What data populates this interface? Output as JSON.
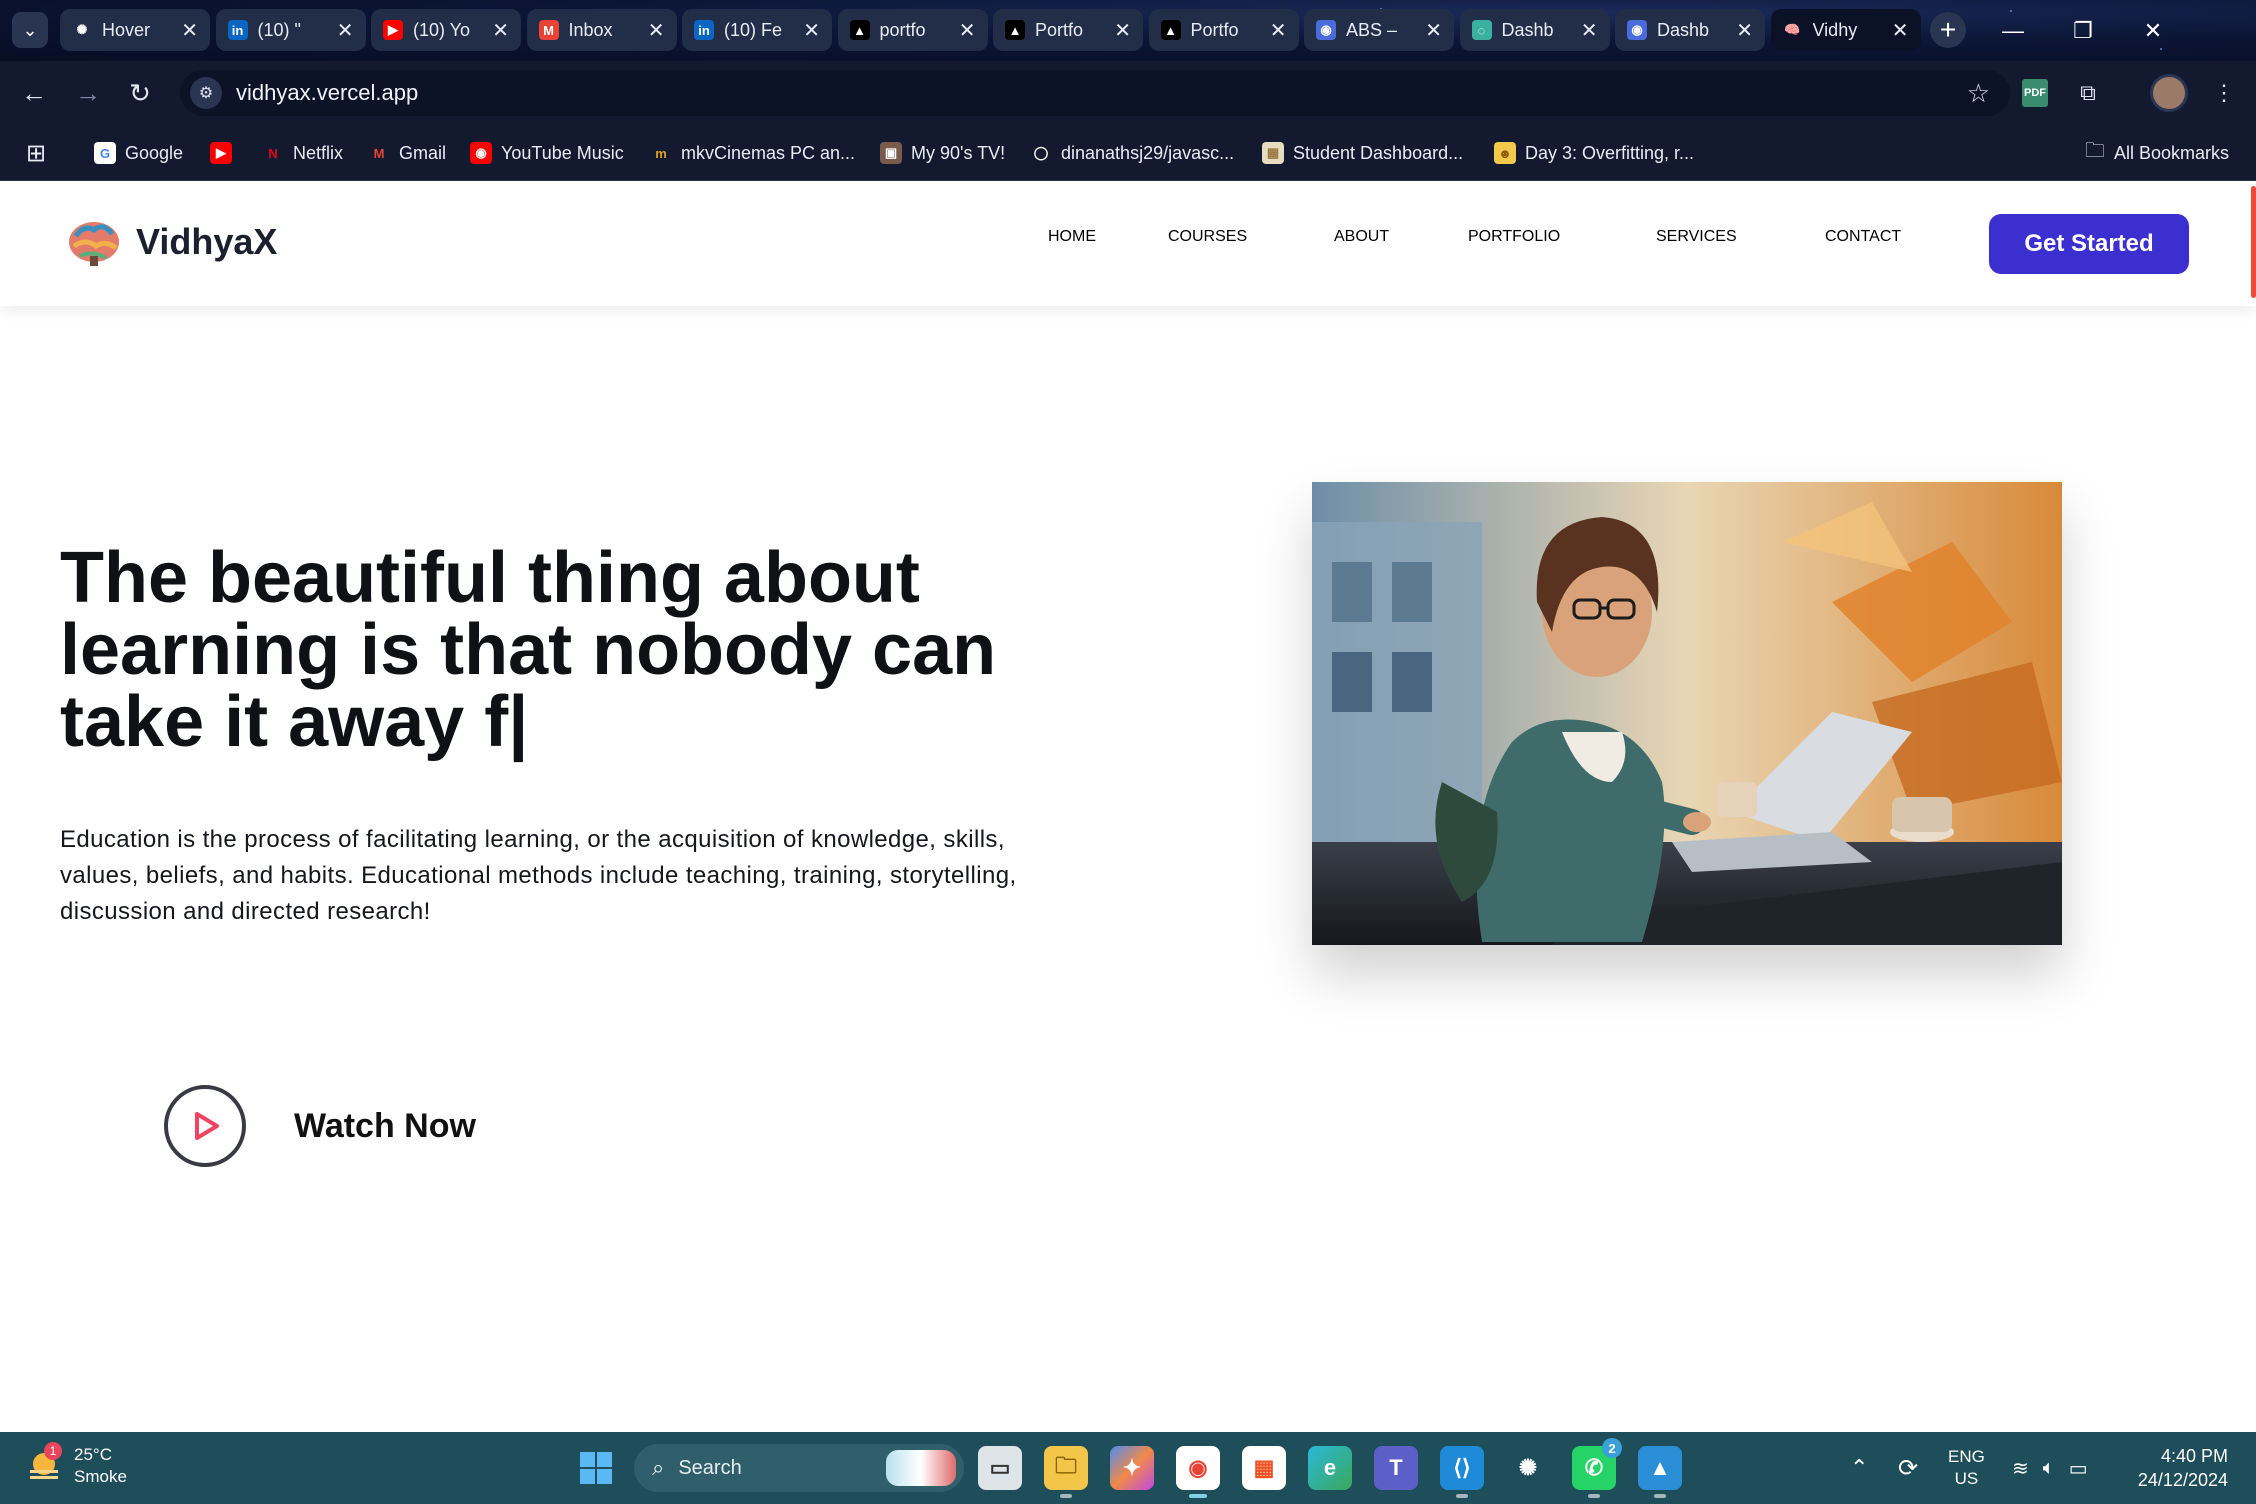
{
  "browser": {
    "tabs": [
      {
        "title": "Hover",
        "fav": "openai",
        "color": "#222d48"
      },
      {
        "title": "(10) \"",
        "fav": "in",
        "color": "#0a66c2"
      },
      {
        "title": "(10) Yo",
        "fav": "▶",
        "color": "#ff0000"
      },
      {
        "title": "Inbox",
        "fav": "M",
        "color": "#ea4335"
      },
      {
        "title": "(10) Fe",
        "fav": "in",
        "color": "#0a66c2"
      },
      {
        "title": "portfo",
        "fav": "▲",
        "color": "#000000"
      },
      {
        "title": "Portfo",
        "fav": "▲",
        "color": "#000000"
      },
      {
        "title": "Portfo",
        "fav": "▲",
        "color": "#000000"
      },
      {
        "title": "ABS –",
        "fav": "◉",
        "color": "#4b6bdc"
      },
      {
        "title": "Dashb",
        "fav": "◌",
        "color": "#3ab0a0"
      },
      {
        "title": "Dashb",
        "fav": "◉",
        "color": "#4b6bdc"
      },
      {
        "title": "Vidhy",
        "fav": "🧠",
        "color": "#0b1228"
      }
    ],
    "url": "vidhyax.vercel.app",
    "bookmarks": [
      {
        "label": "Google",
        "fav": "G",
        "color": "#ffffff",
        "fg": "#4285f4"
      },
      {
        "label": "",
        "fav": "▶",
        "color": "#ff0000",
        "fg": "#fff"
      },
      {
        "label": "Netflix",
        "fav": "N",
        "color": "transparent",
        "fg": "#e50914"
      },
      {
        "label": "Gmail",
        "fav": "M",
        "color": "transparent",
        "fg": "#ea4335"
      },
      {
        "label": "YouTube Music",
        "fav": "◉",
        "color": "#ff0000",
        "fg": "#fff"
      },
      {
        "label": "mkvCinemas PC an...",
        "fav": "m",
        "color": "transparent",
        "fg": "#e0a020"
      },
      {
        "label": "My 90's TV!",
        "fav": "▣",
        "color": "#7a5a4a",
        "fg": "#fff"
      },
      {
        "label": "dinanathsj29/javasc...",
        "fav": "◯",
        "color": "transparent",
        "fg": "#fff"
      },
      {
        "label": "Student Dashboard...",
        "fav": "▦",
        "color": "#e8dcc0",
        "fg": "#9a7a40"
      },
      {
        "label": "Day 3: Overfitting, r...",
        "fav": "☻",
        "color": "#f3c94b",
        "fg": "#8a5a00"
      }
    ],
    "all_bookmarks": "All Bookmarks"
  },
  "site": {
    "brand": "VidhyaX",
    "nav": [
      "HOME",
      "COURSES",
      "ABOUT",
      "PORTFOLIO",
      "SERVICES",
      "CONTACT"
    ],
    "cta": "Get Started",
    "hero_title": "The beautiful thing about learning is that nobody can take it away f|",
    "hero_text": "Education is the process of facilitating learning, or the acquisition of knowledge, skills, values, beliefs, and habits. Educational methods include teaching, training, storytelling, discussion and directed research!",
    "watch_label": "Watch Now"
  },
  "taskbar": {
    "weather_temp": "25°C",
    "weather_desc": "Smoke",
    "weather_badge": "1",
    "search_placeholder": "Search",
    "whatsapp_badge": "2",
    "lang_top": "ENG",
    "lang_bottom": "US",
    "time": "4:40 PM",
    "date": "24/12/2024"
  }
}
